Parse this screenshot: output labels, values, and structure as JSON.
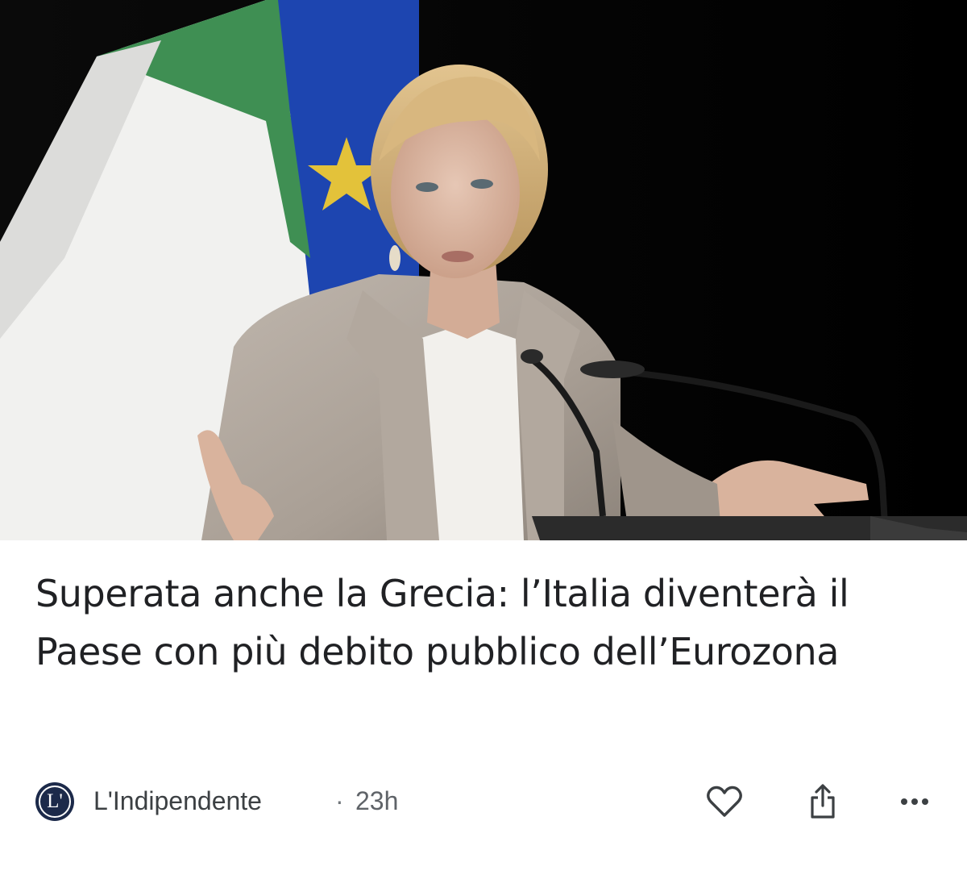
{
  "article": {
    "image_description": "",
    "headline": "Superata anche la Grecia: l’Italia diventerà il Paese con più debito pubblico dell’Eurozona"
  },
  "source": {
    "logo_text": "L'",
    "name": "L'Indipendente",
    "separator": "·",
    "time": "23h"
  },
  "actions": {
    "like_icon": "heart-outline-icon",
    "share_icon": "share-icon",
    "more_icon": "more-horizontal-icon"
  },
  "colors": {
    "headline": "#202124",
    "source_text": "#3c4043",
    "icon": "#3c4043",
    "logo_bg": "#1c2a4a"
  }
}
